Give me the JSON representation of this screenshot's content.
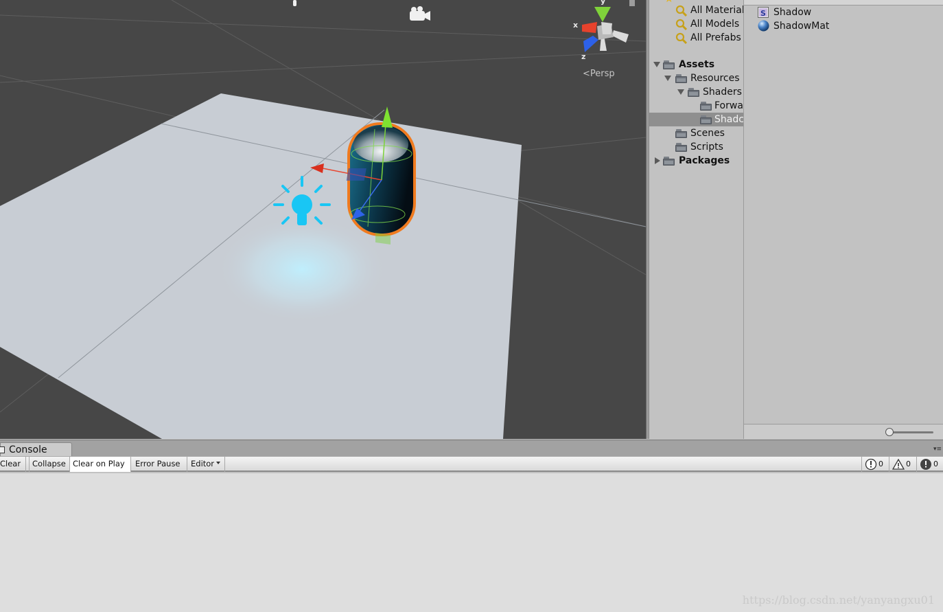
{
  "scene": {
    "projection_label": "Persp",
    "gizmo_axes": {
      "x": "x",
      "y": "y",
      "z": "z"
    }
  },
  "project_tree": {
    "favorites": [
      {
        "label": "All Materials"
      },
      {
        "label": "All Models"
      },
      {
        "label": "All Prefabs"
      }
    ],
    "assets_label": "Assets",
    "resources_label": "Resources",
    "shaders_label": "Shaders",
    "shader_subfolders": [
      {
        "label": "Forwa"
      },
      {
        "label": "Shadc"
      }
    ],
    "scenes_label": "Scenes",
    "scripts_label": "Scripts",
    "packages_label": "Packages"
  },
  "project_files": {
    "items": [
      {
        "label": "Shadow",
        "icon": "shader-icon"
      },
      {
        "label": "ShadowMat",
        "icon": "material-sphere-icon"
      }
    ]
  },
  "console": {
    "tab_label": "Console",
    "toolbar": {
      "clear": "Clear",
      "collapse": "Collapse",
      "clear_on_play": "Clear on Play",
      "error_pause": "Error Pause",
      "editor": "Editor"
    },
    "counts": {
      "info": "0",
      "warnings": "0",
      "errors": "0"
    }
  },
  "watermark": "https://blog.csdn.net/yanyangxu01",
  "colors": {
    "scene_bg": "#474747",
    "plane": "#c8cdd4",
    "selection_outline": "#f07a1e",
    "light_icon": "#19c6f4"
  }
}
